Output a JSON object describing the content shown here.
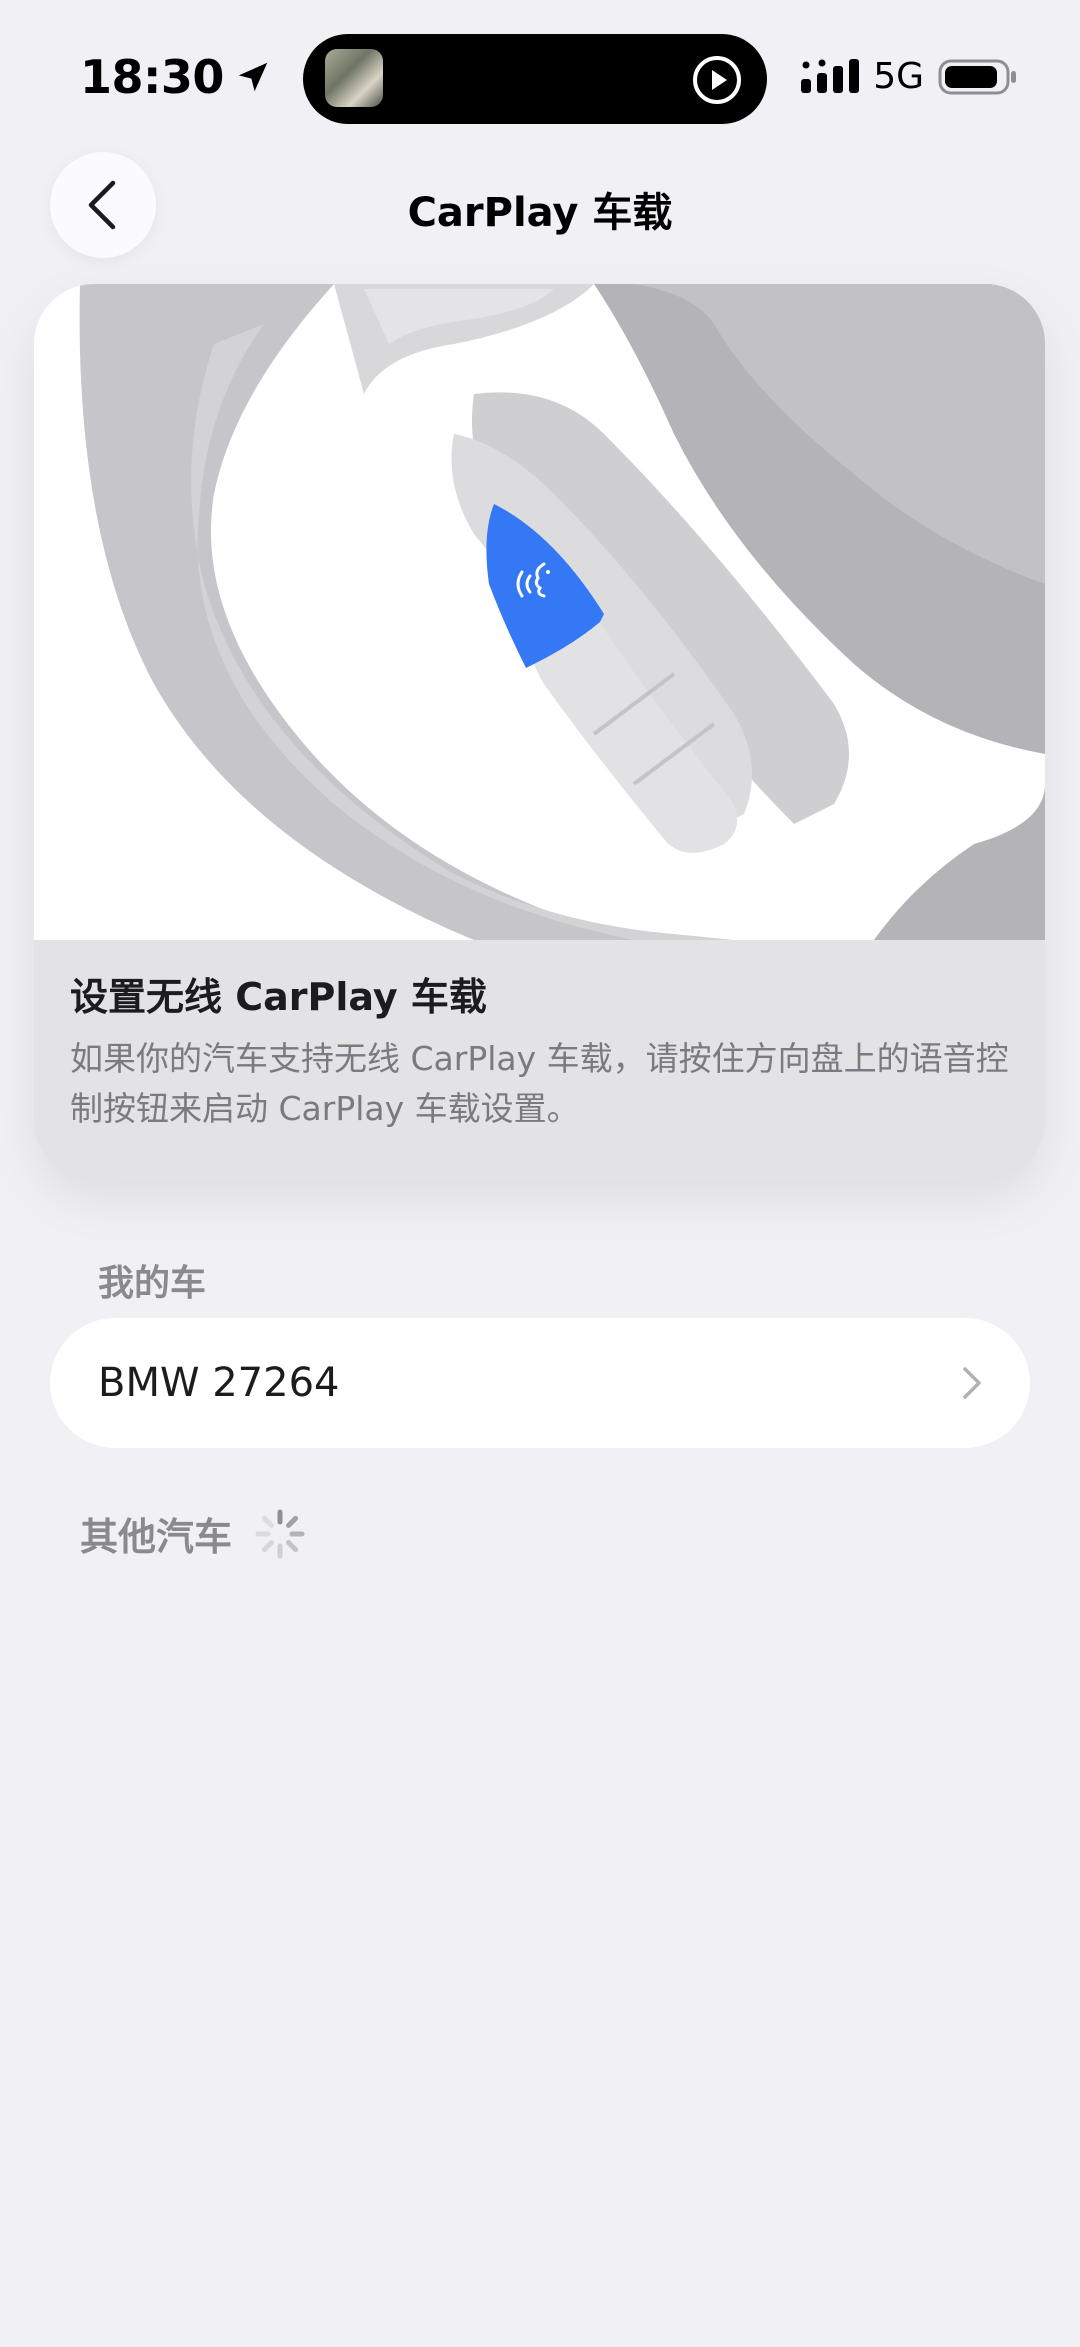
{
  "status_bar": {
    "time": "18:30",
    "network": "5G"
  },
  "header": {
    "title": "CarPlay 车载"
  },
  "hero": {
    "title": "设置无线 CarPlay 车载",
    "description": "如果你的汽车支持无线 CarPlay 车载，请按住方向盘上的语音控制按钮来启动 CarPlay 车载设置。",
    "accent_color": "#3478f6"
  },
  "my_cars": {
    "header": "我的车",
    "items": [
      {
        "name": "BMW 27264"
      }
    ]
  },
  "other_cars": {
    "header": "其他汽车",
    "loading": true
  },
  "icons": {
    "back": "chevron-left-icon",
    "location": "location-arrow-icon",
    "signal": "cellular-signal-icon",
    "battery": "battery-icon",
    "play": "play-circle-icon",
    "spinner": "loading-spinner-icon",
    "voice": "voice-control-icon"
  }
}
